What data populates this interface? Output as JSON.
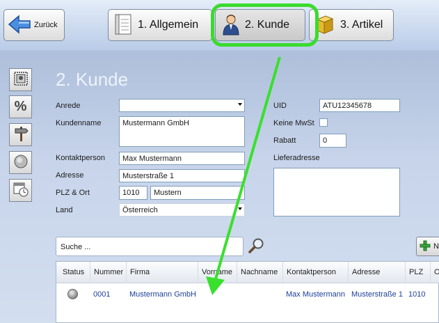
{
  "header": {
    "back_label": "Zurück",
    "tabs": [
      {
        "label": "1. Allgemein"
      },
      {
        "label": "2. Kunde"
      },
      {
        "label": "3. Artikel"
      }
    ]
  },
  "form": {
    "title": "2. Kunde",
    "anrede": {
      "label": "Anrede",
      "value": ""
    },
    "kundenname": {
      "label": "Kundenname",
      "value": "Mustermann GmbH"
    },
    "kontaktperson": {
      "label": "Kontaktperson",
      "value": "Max Mustermann"
    },
    "adresse": {
      "label": "Adresse",
      "value": "Musterstraße 1"
    },
    "plz_ort": {
      "label": "PLZ & Ort",
      "plz": "1010",
      "ort": "Mustern"
    },
    "land": {
      "label": "Land",
      "value": "Österreich"
    },
    "uid": {
      "label": "UID",
      "value": "ATU12345678"
    },
    "keine_mwst": {
      "label": "Keine MwSt",
      "checked": false
    },
    "rabatt": {
      "label": "Rabatt",
      "value": "0"
    },
    "lieferadresse": {
      "label": "Lieferadresse",
      "value": ""
    }
  },
  "search": {
    "placeholder": "Suche ..."
  },
  "new_button": {
    "label": "N"
  },
  "table": {
    "columns": [
      "Status",
      "Nummer",
      "Firma",
      "Vorname",
      "Nachname",
      "Kontaktperson",
      "Adresse",
      "PLZ",
      "O"
    ],
    "rows": [
      {
        "status": "",
        "nummer": "0001",
        "firma": "Mustermann GmbH",
        "vorname": "",
        "nachname": "",
        "kontaktperson": "Max Mustermann",
        "adresse": "Musterstraße 1",
        "plz": "1010",
        "ort": ""
      }
    ]
  },
  "colors": {
    "highlight": "#3adb2e",
    "accent_text": "#1b3f98"
  }
}
